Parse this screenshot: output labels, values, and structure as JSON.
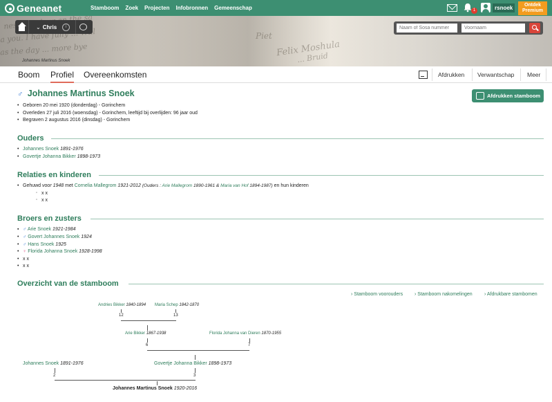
{
  "topbar": {
    "logo_text": "Geneanet",
    "nav": [
      "Stamboom",
      "Zoek",
      "Projecten",
      "Infobronnen",
      "Gemeenschap"
    ],
    "notification_count": "1",
    "username": "rsnoek",
    "premium_line1": "Ontdek",
    "premium_line2": "Premium"
  },
  "banner": {
    "person_pill_name": "Chris",
    "caption": "Johannes Martinus Snoek",
    "search_placeholder_sosa": "Naam of Sosa nummer",
    "search_placeholder_firstname": "Voornaam"
  },
  "tabs": {
    "boom": "Boom",
    "profiel": "Profiel",
    "overeenkomsten": "Overeenkomsten",
    "afdrukken": "Afdrukken",
    "verwantschap": "Verwantschap",
    "meer": "Meer"
  },
  "person": {
    "name": "Johannes Martinus Snoek",
    "born": "Geboren   20 mei 1920 (donderdag) - Gorinchem",
    "died": "Overleden   27 juli 2016 (woensdag) - Gorinchem, leeftijd bij overlijden: 96 jaar oud",
    "buried": "Begraven   2 augustus 2016 (dinsdag) - Gorinchem",
    "print_button": "Afdrukken stamboom"
  },
  "sections": {
    "parents_title": "Ouders",
    "relations_title": "Relaties en kinderen",
    "siblings_title": "Broers en zusters",
    "overview_title": "Overzicht van de stamboom"
  },
  "parents": [
    {
      "name": "Johannes Snoek",
      "years": "1891-1976"
    },
    {
      "name": "Govertje Johanna Bikker",
      "years": "1898-1973"
    }
  ],
  "relation": {
    "prefix": "Gehuwd",
    "when": "voor 1948",
    "met": "met",
    "spouse": "Cornelia Mallegrom",
    "spouse_years": "1921-2012",
    "ouders_open": "(Ouders : ",
    "father": "Arie Mallegrom",
    "father_years": "1890-1961",
    "amp": " & ",
    "mother": "Maria van Hof",
    "mother_years": "1894-1987",
    "ouders_close": ")",
    "suffix": "en hun kinderen",
    "children": [
      "x x",
      "x x"
    ]
  },
  "siblings": [
    {
      "name": "Arie Snoek",
      "years": "1921-1984",
      "sex": "male"
    },
    {
      "name": "Govert Johannes Snoek",
      "years": "1924",
      "sex": "male"
    },
    {
      "name": "Hans Snoek",
      "years": "1925",
      "sex": "male"
    },
    {
      "name": "Florida Johanna Snoek",
      "years": "1928-1998",
      "sex": "female"
    },
    {
      "name": "x x",
      "years": "",
      "sex": ""
    },
    {
      "name": "x x",
      "years": "",
      "sex": ""
    }
  ],
  "tree_links": [
    "Stamboom voorouders",
    "Stamboom nakomelingen",
    "Afdrukbare stambomen"
  ],
  "tree": {
    "n12": {
      "name": "Andries Bikker",
      "years": "1840-1894",
      "num": "12"
    },
    "n13": {
      "name": "Maria Schep",
      "years": "1842-1870",
      "num": "13"
    },
    "n6": {
      "name": "Arie Bikker",
      "years": "1867-1938",
      "num": "6"
    },
    "n7": {
      "name": "Florida Johanna van Dieren",
      "years": "1870-1955",
      "num": "7"
    },
    "n2": {
      "name": "Johannes Snoek",
      "years": "1891-1976",
      "num": "2"
    },
    "n3": {
      "name": "Govertje Johanna Bikker",
      "years": "1898-1973",
      "num": "3"
    },
    "root": {
      "name": "Johannes Martinus Snoek",
      "years": "1920-2016"
    }
  },
  "colors": {
    "brand": "#3d8f72",
    "link": "#2e7d5b",
    "premium": "#f39c1f",
    "alert": "#e23b2e"
  }
}
